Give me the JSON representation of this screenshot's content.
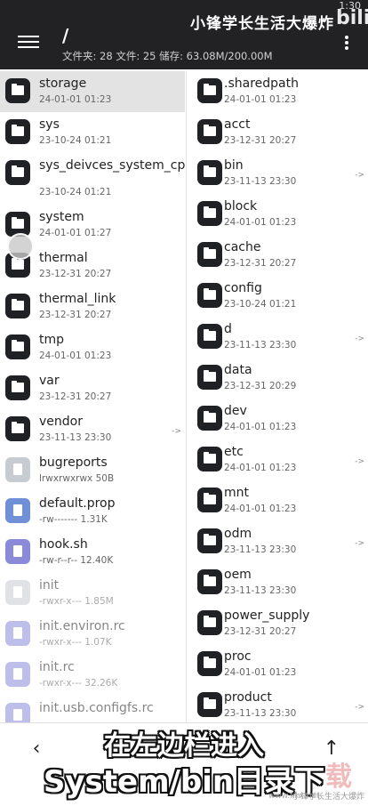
{
  "header": {
    "clock": "1:30",
    "watermark": "小锋学长生活大爆炸",
    "watermark_logo": "bili",
    "path": "/",
    "stats": "文件夹: 28  文件: 25  储存: 63.08M/200.00M"
  },
  "left_pane": [
    {
      "name": "storage",
      "meta": "24-01-01 01:23",
      "type": "folder"
    },
    {
      "name": "sys",
      "meta": "23-10-24 01:21",
      "type": "folder"
    },
    {
      "name": "sys_deivces_system_cpu",
      "meta": "23-10-24 01:21",
      "type": "folder"
    },
    {
      "name": "system",
      "meta": "24-01-01 01:27",
      "type": "folder"
    },
    {
      "name": "thermal",
      "meta": "23-12-31 20:27",
      "type": "folder"
    },
    {
      "name": "thermal_link",
      "meta": "23-12-31 20:27",
      "type": "folder"
    },
    {
      "name": "tmp",
      "meta": "24-01-01 01:23",
      "type": "folder"
    },
    {
      "name": "var",
      "meta": "23-12-31 20:27",
      "type": "folder"
    },
    {
      "name": "vendor",
      "meta": "23-11-13 23:30",
      "type": "folder",
      "link": "->"
    },
    {
      "name": "bugreports",
      "meta": "lrwxrwxrwx  50B",
      "type": "file"
    },
    {
      "name": "default.prop",
      "meta": "-rw-------  1.31K",
      "type": "file"
    },
    {
      "name": "hook.sh",
      "meta": "-rw-r--r--  12.40K",
      "type": "file"
    },
    {
      "name": "init",
      "meta": "-rwxr-x---  1.85M",
      "type": "file"
    },
    {
      "name": "init.environ.rc",
      "meta": "-rwxr-x---  1.07K",
      "type": "file"
    },
    {
      "name": "init.rc",
      "meta": "-rwxr-x---  32.26K",
      "type": "file"
    },
    {
      "name": "init.usb.configfs.rc",
      "meta": "",
      "type": "file"
    }
  ],
  "right_pane": [
    {
      "name": ".sharedpath",
      "meta": "24-01-01 01:23"
    },
    {
      "name": "acct",
      "meta": "23-12-31 20:27"
    },
    {
      "name": "bin",
      "meta": "23-11-13 23:30",
      "link": "->"
    },
    {
      "name": "block",
      "meta": "24-01-01 01:23"
    },
    {
      "name": "cache",
      "meta": "23-12-31 20:27"
    },
    {
      "name": "config",
      "meta": "23-10-24 01:21"
    },
    {
      "name": "d",
      "meta": "23-11-13 23:30",
      "link": "->"
    },
    {
      "name": "data",
      "meta": "23-12-31 20:29"
    },
    {
      "name": "dev",
      "meta": "24-01-01 01:23"
    },
    {
      "name": "etc",
      "meta": "24-01-01 01:23",
      "link": "->"
    },
    {
      "name": "mnt",
      "meta": "24-01-01 01:23"
    },
    {
      "name": "odm",
      "meta": "23-11-13 23:30",
      "link": "->"
    },
    {
      "name": "oem",
      "meta": "23-11-13 23:30"
    },
    {
      "name": "power_supply",
      "meta": "23-12-31 20:27"
    },
    {
      "name": "proc",
      "meta": "24-01-01 01:23"
    },
    {
      "name": "product",
      "meta": "23-11-13 23:30",
      "link": "->"
    }
  ],
  "footer": {
    "back": "‹",
    "up": "↑",
    "subtitle_line1": "在左边栏进入",
    "subtitle_line2": "System/bin目录下",
    "wm_bottom": "小锋学长生活大爆炸",
    "wm_url": "www.kkx.net",
    "wm_big": "载"
  }
}
